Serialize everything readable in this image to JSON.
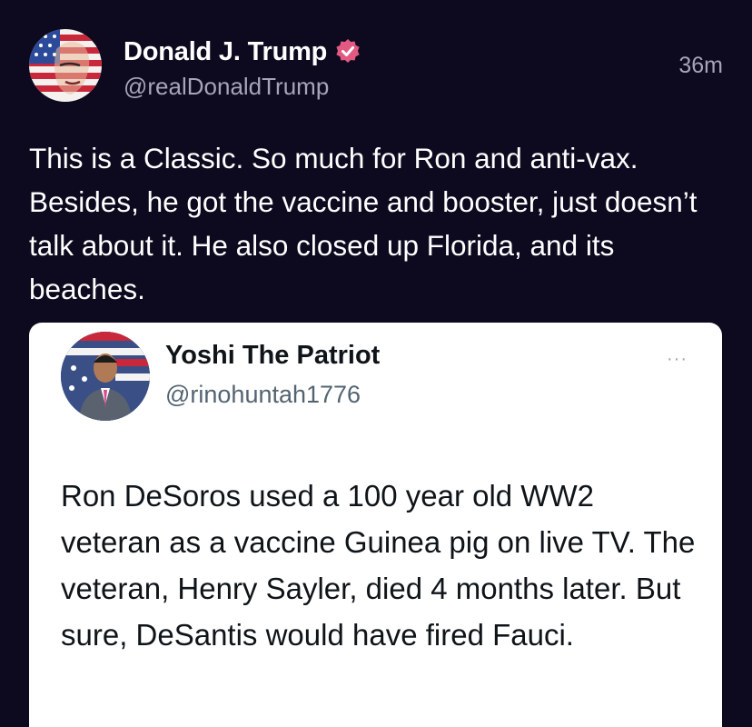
{
  "post": {
    "author_name": "Donald J. Trump",
    "handle": "@realDonaldTrump",
    "timestamp": "36m",
    "text": "This is a Classic. So much for Ron and anti-vax. Besides, he got the vaccine and booster, just doesn’t talk about it. He also closed up Florida, and its beaches.",
    "verified_color": "#e25a82"
  },
  "embed": {
    "author_name": "Yoshi The Patriot",
    "handle": "@rinohuntah1776",
    "more_label": "···",
    "text": "Ron DeSoros used a 100 year old WW2 veteran as a vaccine Guinea pig on live TV. The veteran, Henry Sayler, died 4 months later. But sure, DeSantis would have fired Fauci."
  },
  "colors": {
    "background": "#0d0a1f",
    "secondary_text": "#a7a4b8",
    "card_background": "#ffffff",
    "card_secondary_text": "#536471"
  },
  "icons": {
    "verified": "verified-badge-icon",
    "more": "more-options-icon"
  }
}
